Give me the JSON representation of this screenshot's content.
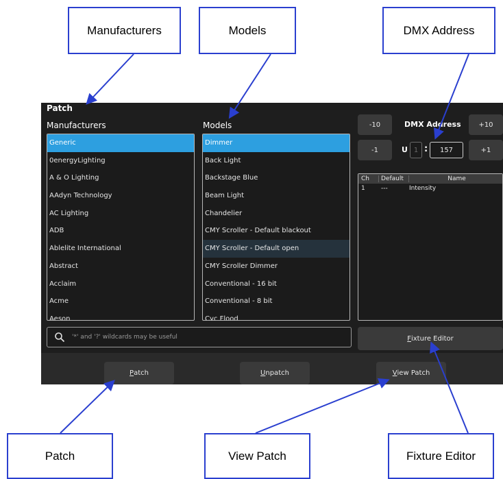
{
  "callouts": {
    "manufacturers": "Manufacturers",
    "models": "Models",
    "dmx_address": "DMX Address",
    "patch": "Patch",
    "view_patch": "View Patch",
    "fixture_editor": "Fixture Editor"
  },
  "app": {
    "title": "Patch",
    "manufacturers_header": "Manufacturers",
    "models_header": "Models",
    "manufacturers": [
      "Generic",
      "0energyLighting",
      "A & O Lighting",
      "AAdyn Technology",
      "AC Lighting",
      "ADB",
      "Ablelite International",
      "Abstract",
      "Acclaim",
      "Acme",
      "Aeson"
    ],
    "selected_manufacturer": "Generic",
    "models": [
      "Dimmer",
      "Back Light",
      "Backstage Blue",
      "Beam Light",
      "Chandelier",
      "CMY Scroller - Default blackout",
      "CMY Scroller - Default open",
      "CMY Scroller Dimmer",
      "Conventional - 16 bit",
      "Conventional - 8 bit",
      "Cyc Flood"
    ],
    "selected_model": "Dimmer",
    "hovered_model": "CMY Scroller - Default open",
    "dmx": {
      "label": "DMX Address",
      "minus10": "-10",
      "plus10": "+10",
      "minus1": "-1",
      "plus1": "+1",
      "universe_label": "U",
      "universe": "1",
      "separator": ":",
      "address": "157"
    },
    "channels": {
      "headers": [
        "Ch",
        "Default",
        "Name"
      ],
      "rows": [
        [
          "1",
          "---",
          "Intensity"
        ]
      ]
    },
    "search_placeholder": "'*' and '?' wildcards may be useful",
    "buttons": {
      "fixture_editor_u": "F",
      "fixture_editor_rest": "ixture Editor",
      "patch_u": "P",
      "patch_rest": "atch",
      "unpatch_u": "U",
      "unpatch_rest": "npatch",
      "view_patch_u": "V",
      "view_patch_rest": "iew Patch"
    }
  },
  "colors": {
    "callout_border": "#2a3fcf",
    "arrow": "#2a3fcf",
    "selection": "#2d9fe0",
    "app_bg": "#1e1e1e"
  }
}
